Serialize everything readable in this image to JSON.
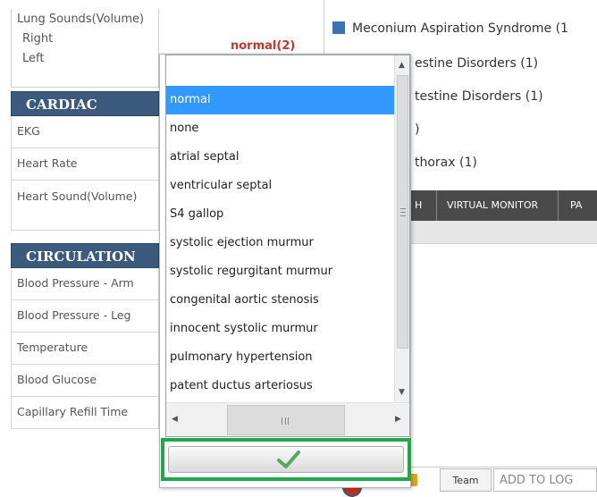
{
  "left": {
    "lung": {
      "title": "Lung Sounds(Volume)",
      "right": "Right",
      "left": "Left"
    },
    "cardiac_header": "CARDIAC",
    "cardiac_rows": [
      "EKG",
      "Heart Rate",
      "Heart Sound(Volume)"
    ],
    "circulation_header": "CIRCULATION",
    "circulation_rows": [
      "Blood Pressure - Arm",
      "Blood Pressure - Leg",
      "Temperature",
      "Blood Glucose",
      "Capillary Refill Time"
    ]
  },
  "current_value": "normal(2)",
  "right": {
    "diagnoses": [
      "Meconium Aspiration Syndrome (1",
      "estine Disorders (1)",
      "testine Disorders (1)",
      ")",
      "thorax (1)"
    ],
    "tabs": [
      "H",
      "VIRTUAL MONITOR",
      "PA"
    ],
    "team_button": "Team",
    "add_to_log": "ADD TO LOG"
  },
  "dropdown": {
    "search_value": "",
    "options": [
      "normal",
      "none",
      "atrial septal",
      "ventricular septal",
      "S4 gallop",
      "systolic ejection murmur",
      "systolic regurgitant murmur",
      "congenital aortic stenosis",
      "innocent systolic murmur",
      "pulmonary hypertension",
      "patent ductus arteriosus"
    ],
    "selected": "normal"
  },
  "colors": {
    "section_header": "#3b5a7d",
    "selection": "#3399ff",
    "confirm_highlight": "#22a84b",
    "value_red": "#c0392b",
    "check": "#5aa66a"
  },
  "icons": {
    "confirm": "check-icon",
    "scroll_up": "arrow-up-icon",
    "scroll_down": "arrow-down-icon",
    "scroll_left": "arrow-left-icon",
    "scroll_right": "arrow-right-icon"
  }
}
